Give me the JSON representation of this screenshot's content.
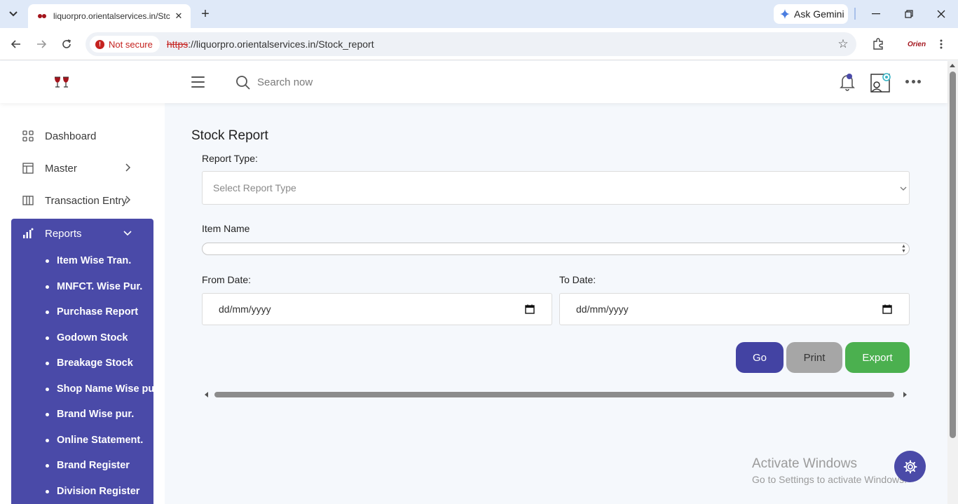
{
  "browser": {
    "tab_title": "liquorpro.orientalservices.in/Stc",
    "ask_gemini": "Ask Gemini",
    "not_secure": "Not secure",
    "url_scheme": "https",
    "url_rest": "://liquorpro.orientalservices.in/Stock_report",
    "profile_label": "Orien"
  },
  "header": {
    "search_placeholder": "Search now"
  },
  "sidebar": {
    "items": [
      {
        "label": "Dashboard",
        "icon": "grid-icon"
      },
      {
        "label": "Master",
        "icon": "table-icon"
      },
      {
        "label": "Transaction Entry",
        "icon": "columns-icon"
      }
    ],
    "reports": {
      "label": "Reports",
      "icon": "bar-chart-icon",
      "sub_items": [
        "Item Wise Tran.",
        "MNFCT. Wise Pur.",
        "Purchase Report",
        "Godown Stock",
        "Breakage Stock",
        "Shop Name Wise pur.",
        "Brand Wise pur.",
        "Online Statement.",
        "Brand Register",
        "Division Register"
      ]
    }
  },
  "main": {
    "title": "Stock Report",
    "report_type_label": "Report Type:",
    "report_type_placeholder": "Select Report Type",
    "item_name_label": "Item Name",
    "from_date_label": "From Date:",
    "to_date_label": "To Date:",
    "date_placeholder": "dd/mm/yyyy",
    "buttons": {
      "go": "Go",
      "print": "Print",
      "export": "Export"
    }
  },
  "overlay": {
    "activate_title": "Activate Windows",
    "activate_sub": "Go to Settings to activate Windows."
  },
  "colors": {
    "primary": "#4a4aa8",
    "go": "#4343a3",
    "print": "#a6a6a6",
    "export": "#4bb04f",
    "danger": "#c5221f"
  }
}
